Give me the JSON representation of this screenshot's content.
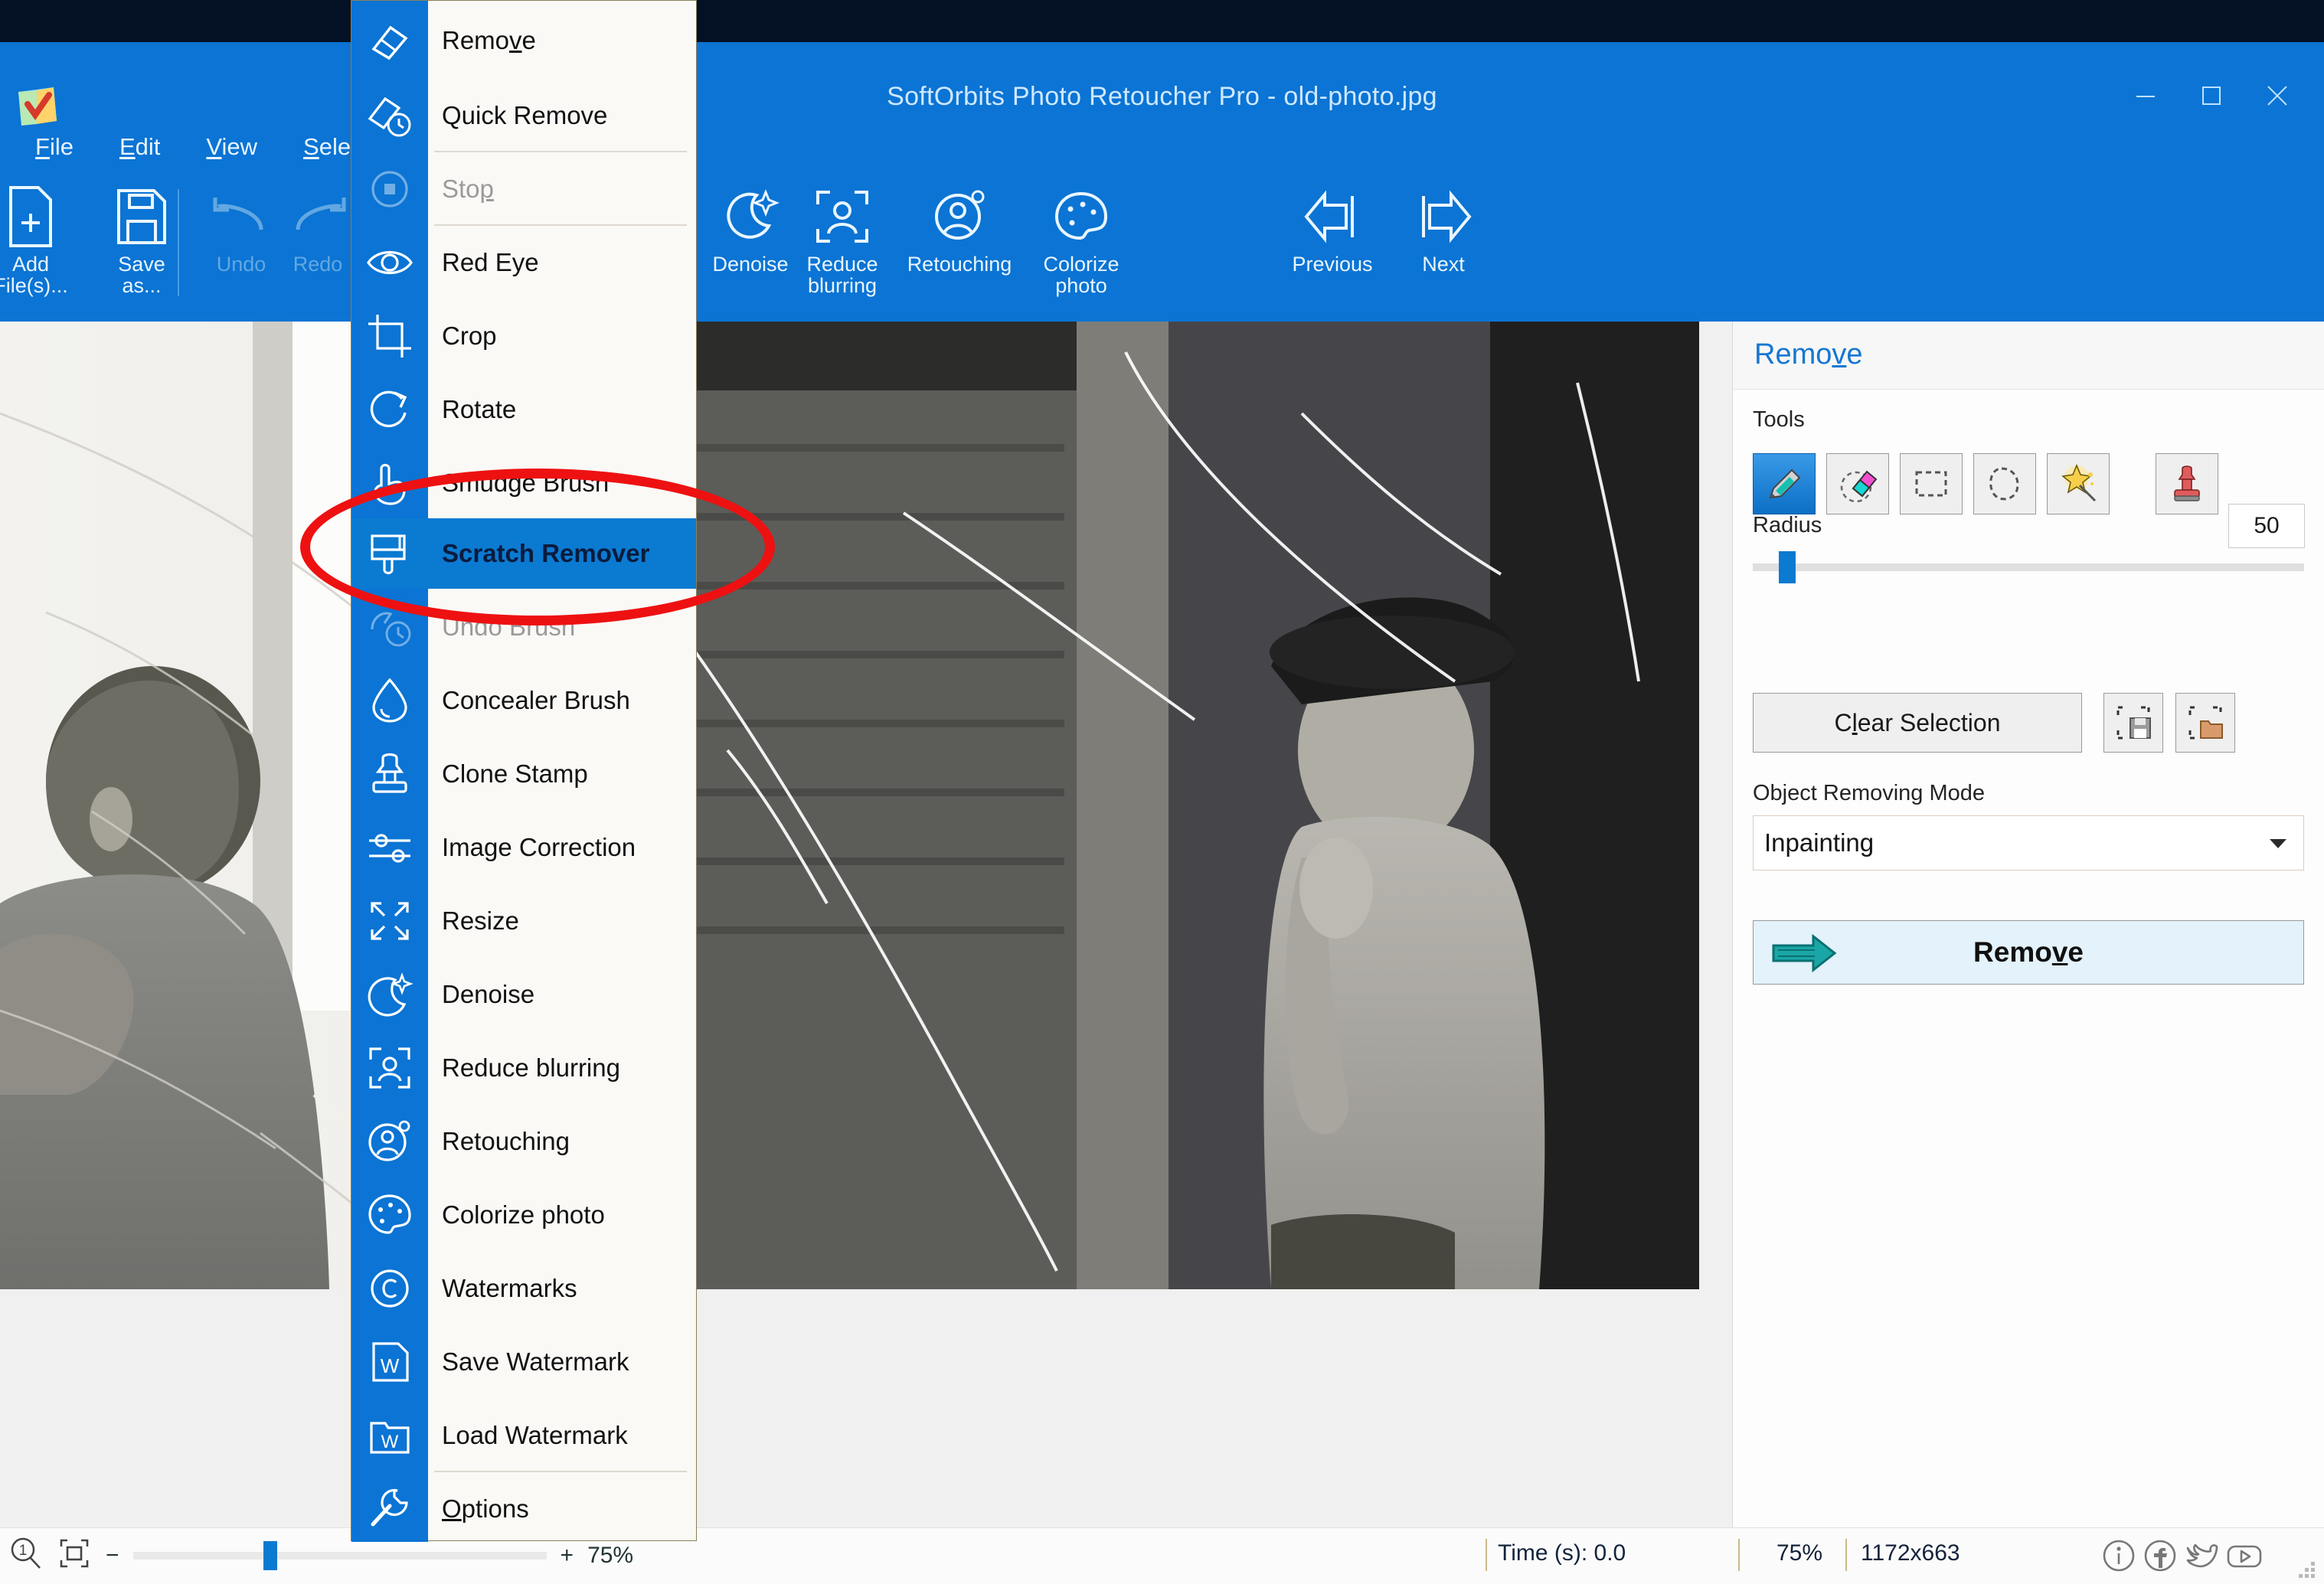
{
  "window": {
    "title": "SoftOrbits Photo Retoucher Pro - old-photo.jpg",
    "minimize": "minimize-button",
    "maximize": "maximize-button",
    "close": "close-button",
    "accent": "#0b74d4"
  },
  "menubar": [
    {
      "label": "File",
      "accel": "F"
    },
    {
      "label": "Edit",
      "accel": "E"
    },
    {
      "label": "View",
      "accel": "V"
    },
    {
      "label": "Selection",
      "accel": "S"
    }
  ],
  "ribbon": {
    "items": [
      {
        "label_line1": "Add",
        "label_line2": "File(s)...",
        "icon": "add-file-icon",
        "disabled": false
      },
      {
        "label_line1": "Save",
        "label_line2": "as...",
        "icon": "save-as-icon",
        "disabled": false
      },
      {
        "label_line1": "Undo",
        "label_line2": "",
        "icon": "undo-icon",
        "disabled": true
      },
      {
        "label_line1": "Redo",
        "label_line2": "",
        "icon": "redo-icon",
        "disabled": true
      },
      {
        "label_line1": "Denoise",
        "label_line2": "",
        "icon": "denoise-icon",
        "disabled": false
      },
      {
        "label_line1": "Reduce",
        "label_line2": "blurring",
        "icon": "reduce-blurring-icon",
        "disabled": false
      },
      {
        "label_line1": "Retouching",
        "label_line2": "",
        "icon": "retouching-icon",
        "disabled": false
      },
      {
        "label_line1": "Colorize",
        "label_line2": "photo",
        "icon": "colorize-photo-icon",
        "disabled": false
      },
      {
        "label_line1": "Previous",
        "label_line2": "",
        "icon": "previous-icon",
        "disabled": false
      },
      {
        "label_line1": "Next",
        "label_line2": "",
        "icon": "next-icon",
        "disabled": false
      }
    ],
    "occluded_label_fragment": "on"
  },
  "dropdown": {
    "highlighted": "Scratch Remover",
    "items": [
      {
        "label": "Remove",
        "accel": "v",
        "icon": "eraser-icon",
        "disabled": false,
        "sep_after": false
      },
      {
        "label": "Quick Remove",
        "accel": "",
        "icon": "quick-eraser-icon",
        "disabled": false,
        "sep_after": true
      },
      {
        "label": "Stop",
        "accel": "",
        "icon": "stop-icon",
        "disabled": true,
        "sep_after": true
      },
      {
        "label": "Red Eye",
        "accel": "",
        "icon": "eye-icon",
        "disabled": false,
        "sep_after": false
      },
      {
        "label": "Crop",
        "accel": "",
        "icon": "crop-icon",
        "disabled": false,
        "sep_after": false
      },
      {
        "label": "Rotate",
        "accel": "",
        "icon": "rotate-icon",
        "disabled": false,
        "sep_after": false
      },
      {
        "label": "Smudge Brush",
        "accel": "",
        "icon": "smudge-hand-icon",
        "disabled": false,
        "sep_after": false
      },
      {
        "label": "Scratch Remover",
        "accel": "",
        "icon": "paint-brush-icon",
        "disabled": false,
        "sep_after": false
      },
      {
        "label": "Undo Brush",
        "accel": "",
        "icon": "undo-brush-icon",
        "disabled": true,
        "sep_after": false
      },
      {
        "label": "Concealer Brush",
        "accel": "",
        "icon": "droplet-icon",
        "disabled": false,
        "sep_after": false
      },
      {
        "label": "Clone Stamp",
        "accel": "",
        "icon": "clone-stamp-icon",
        "disabled": false,
        "sep_after": false
      },
      {
        "label": "Image Correction",
        "accel": "",
        "icon": "sliders-icon",
        "disabled": false,
        "sep_after": false
      },
      {
        "label": "Resize",
        "accel": "",
        "icon": "resize-icon",
        "disabled": false,
        "sep_after": false
      },
      {
        "label": "Denoise",
        "accel": "",
        "icon": "moon-sparkle-icon",
        "disabled": false,
        "sep_after": false
      },
      {
        "label": "Reduce blurring",
        "accel": "",
        "icon": "face-frame-icon",
        "disabled": false,
        "sep_after": false
      },
      {
        "label": "Retouching",
        "accel": "",
        "icon": "face-gear-icon",
        "disabled": false,
        "sep_after": false
      },
      {
        "label": "Colorize photo",
        "accel": "",
        "icon": "palette-icon",
        "disabled": false,
        "sep_after": false
      },
      {
        "label": "Watermarks",
        "accel": "",
        "icon": "copyright-icon",
        "disabled": false,
        "sep_after": false
      },
      {
        "label": "Save Watermark",
        "accel": "",
        "icon": "save-watermark-icon",
        "disabled": false,
        "sep_after": false
      },
      {
        "label": "Load Watermark",
        "accel": "",
        "icon": "load-watermark-icon",
        "disabled": false,
        "sep_after": true
      },
      {
        "label": "Options",
        "accel": "O",
        "icon": "wrench-icon",
        "disabled": false,
        "sep_after": false
      }
    ]
  },
  "right_panel": {
    "title": "Remove",
    "tools_label": "Tools",
    "tools": [
      {
        "name": "marker-tool",
        "selected": true
      },
      {
        "name": "eraser-tool",
        "selected": false
      },
      {
        "name": "rectangle-select-tool",
        "selected": false
      },
      {
        "name": "lasso-select-tool",
        "selected": false
      },
      {
        "name": "magic-wand-tool",
        "selected": false
      },
      {
        "name": "clone-stamp-tool",
        "selected": false
      }
    ],
    "radius_label": "Radius",
    "radius_value": "50",
    "clear_selection_label": "Clear Selection",
    "save_selection_icon": "save-selection-icon",
    "load_selection_icon": "load-selection-icon",
    "mode_label": "Object Removing Mode",
    "mode_value": "Inpainting",
    "mode_options": [
      "Inpainting"
    ],
    "remove_button_label": "Remove"
  },
  "status_bar": {
    "zoom_out_label": "−",
    "zoom_in_label": "+",
    "zoom_percent_left": "75%",
    "time_label": "Time (s): 0.0",
    "zoom_percent_right": "75%",
    "dimensions": "1172x663",
    "icons": [
      "info-icon",
      "facebook-icon",
      "twitter-icon",
      "youtube-icon"
    ]
  },
  "annotation": {
    "type": "red-ellipse-highlight",
    "target": "Scratch Remover",
    "color": "#ee1111"
  }
}
